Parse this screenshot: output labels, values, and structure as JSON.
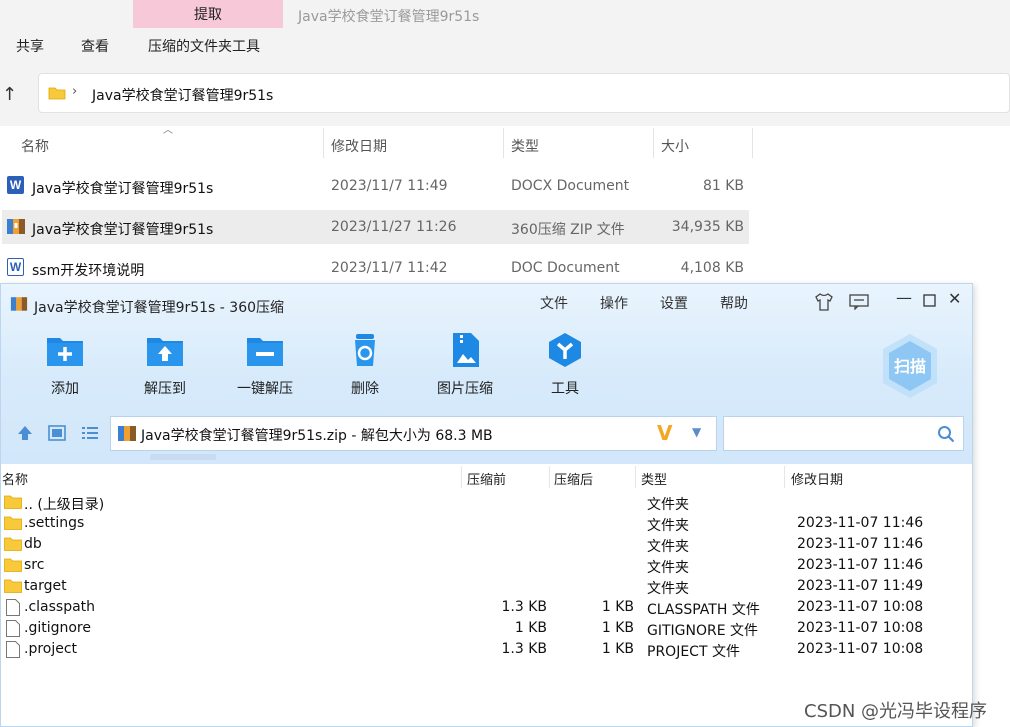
{
  "explorer": {
    "extract_tab": "提取",
    "window_title": "Java学校食堂订餐管理9r51s",
    "ribbon": [
      "共享",
      "查看",
      "压缩的文件夹工具"
    ],
    "address": "Java学校食堂订餐管理9r51s",
    "columns": [
      "名称",
      "修改日期",
      "类型",
      "大小"
    ],
    "files": [
      {
        "name": "Java学校食堂订餐管理9r51s",
        "date": "2023/11/7 11:49",
        "type": "DOCX Document",
        "size": "81 KB",
        "icon": "word-docx-icon"
      },
      {
        "name": "Java学校食堂订餐管理9r51s",
        "date": "2023/11/27 11:26",
        "type": "360压缩 ZIP 文件",
        "size": "34,935 KB",
        "icon": "zip-archive-icon"
      },
      {
        "name": "ssm开发环境说明",
        "date": "2023/11/7 11:42",
        "type": "DOC Document",
        "size": "4,108 KB",
        "icon": "word-doc-icon"
      }
    ]
  },
  "zip": {
    "title": "Java学校食堂订餐管理9r51s - 360压缩",
    "menu": [
      "文件",
      "操作",
      "设置",
      "帮助"
    ],
    "tools": [
      "添加",
      "解压到",
      "一键解压",
      "删除",
      "图片压缩",
      "工具"
    ],
    "scan_label": "扫描",
    "path": "Java学校食堂订餐管理9r51s.zip - 解包大小为 68.3 MB",
    "columns": [
      "名称",
      "压缩前",
      "压缩后",
      "类型",
      "修改日期"
    ],
    "entries": [
      {
        "name": ".. (上级目录)",
        "before": "",
        "after": "",
        "type": "文件夹",
        "date": "",
        "kind": "folder"
      },
      {
        "name": ".settings",
        "before": "",
        "after": "",
        "type": "文件夹",
        "date": "2023-11-07 11:46",
        "kind": "folder"
      },
      {
        "name": "db",
        "before": "",
        "after": "",
        "type": "文件夹",
        "date": "2023-11-07 11:46",
        "kind": "folder"
      },
      {
        "name": "src",
        "before": "",
        "after": "",
        "type": "文件夹",
        "date": "2023-11-07 11:46",
        "kind": "folder"
      },
      {
        "name": "target",
        "before": "",
        "after": "",
        "type": "文件夹",
        "date": "2023-11-07 11:49",
        "kind": "folder"
      },
      {
        "name": ".classpath",
        "before": "1.3 KB",
        "after": "1 KB",
        "type": "CLASSPATH 文件",
        "date": "2023-11-07 10:08",
        "kind": "file"
      },
      {
        "name": ".gitignore",
        "before": "1 KB",
        "after": "1 KB",
        "type": "GITIGNORE 文件",
        "date": "2023-11-07 10:08",
        "kind": "file"
      },
      {
        "name": ".project",
        "before": "1.3 KB",
        "after": "1 KB",
        "type": "PROJECT 文件",
        "date": "2023-11-07 10:08",
        "kind": "file"
      }
    ]
  },
  "watermark": "CSDN @光冯毕设程序",
  "colors": {
    "accent": "#1e88e5",
    "selected_row": "#ececec",
    "extract_tab": "#f7c8d8",
    "folder": "#f8c93a"
  }
}
